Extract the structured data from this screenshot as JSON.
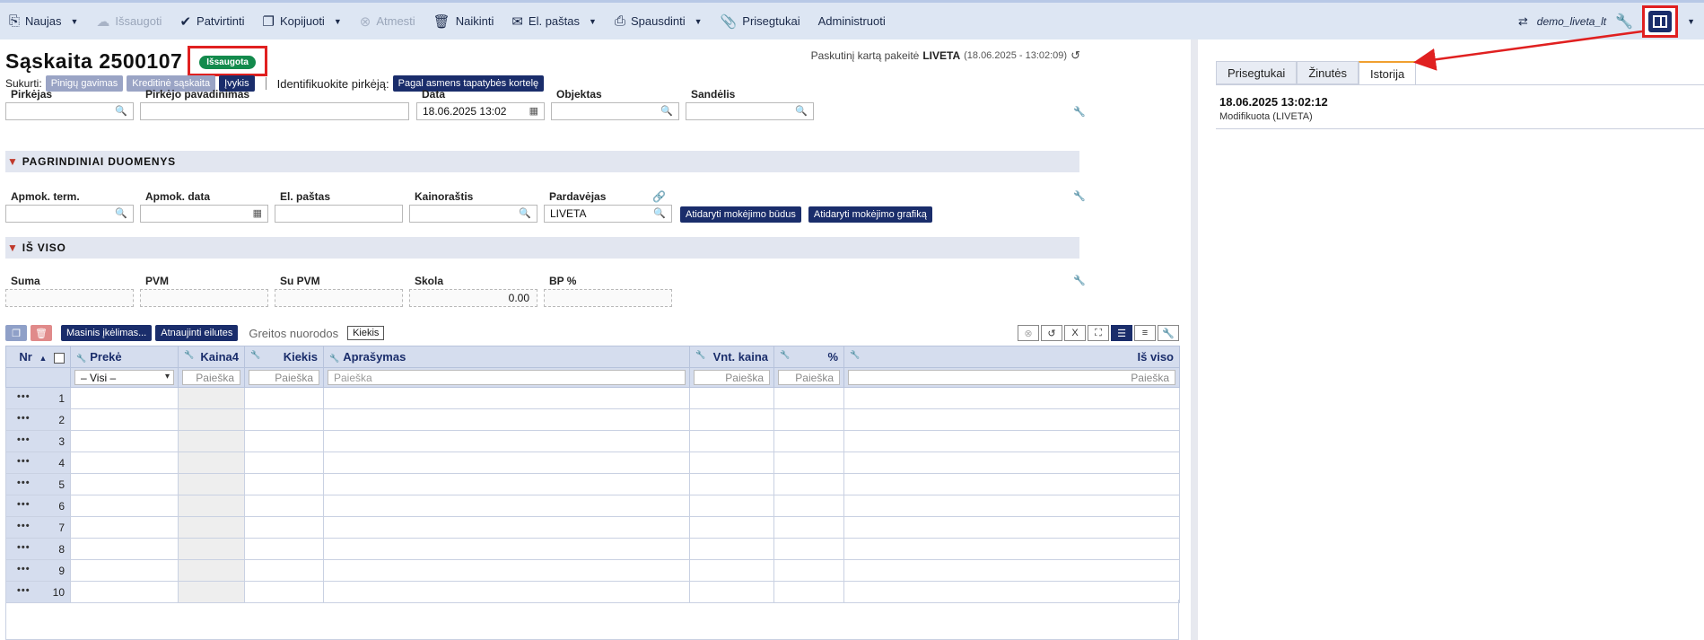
{
  "toolbar": {
    "new": "Naujas",
    "save": "Išsaugoti",
    "confirm": "Patvirtinti",
    "copy": "Kopijuoti",
    "cancel": "Atmesti",
    "delete": "Naikinti",
    "email": "El. paštas",
    "print": "Spausdinti",
    "attachments": "Prisegtukai",
    "administrate": "Administruoti",
    "user": "demo_liveta_lt"
  },
  "header": {
    "title": "Sąskaita 2500107",
    "status": "Išsaugota",
    "last_modified_label": "Paskutinį kartą pakeitė",
    "last_modified_user": "LIVETA",
    "last_modified_time": "(18.06.2025 - 13:02:09)"
  },
  "create": {
    "label": "Sukurti:",
    "payment_request": "Pinigų gavimas",
    "credit_invoice": "Kreditinė sąskaita",
    "event": "Įvykis",
    "identify_label": "Identifikuokite pirkėją:",
    "identify_button": "Pagal asmens tapatybės kortelę"
  },
  "fields": {
    "buyer": {
      "label": "Pirkėjas",
      "value": ""
    },
    "buyer_name": {
      "label": "Pirkėjo pavadinimas",
      "value": ""
    },
    "date": {
      "label": "Data",
      "value": "18.06.2025 13:02"
    },
    "object": {
      "label": "Objektas",
      "value": ""
    },
    "warehouse": {
      "label": "Sandėlis",
      "value": ""
    }
  },
  "section_main": {
    "title": "PAGRINDINIAI DUOMENYS",
    "payment_term": {
      "label": "Apmok. term.",
      "value": ""
    },
    "payment_date": {
      "label": "Apmok. data",
      "value": ""
    },
    "email": {
      "label": "El. paštas",
      "value": ""
    },
    "pricelist": {
      "label": "Kainoraštis",
      "value": ""
    },
    "seller": {
      "label": "Pardavėjas",
      "value": "LIVETA"
    },
    "open_payment_methods": "Atidaryti mokėjimo būdus",
    "open_payment_schedule": "Atidaryti mokėjimo grafiką"
  },
  "section_totals": {
    "title": "IŠ VISO",
    "sum": {
      "label": "Suma",
      "value": ""
    },
    "vat": {
      "label": "PVM",
      "value": ""
    },
    "with_vat": {
      "label": "Su PVM",
      "value": ""
    },
    "debt": {
      "label": "Skola",
      "value": "0.00"
    },
    "bp": {
      "label": "BP %",
      "value": ""
    }
  },
  "grid_toolbar": {
    "mass_upload": "Masinis įkėlimas...",
    "update_rows": "Atnaujinti eilutes",
    "quick_links": "Greitos nuorodos",
    "quantity": "Kiekis"
  },
  "grid": {
    "columns": [
      "Nr",
      "Prekė",
      "Kaina4",
      "Kiekis",
      "Aprašymas",
      "Vnt. kaina",
      "%",
      "Iš viso"
    ],
    "filter_all": "– Visi –",
    "filter_search": "Paieška",
    "rows": [
      "1",
      "2",
      "3",
      "4",
      "5",
      "6",
      "7",
      "8",
      "9",
      "10"
    ]
  },
  "side_panel": {
    "tabs": [
      "Prisegtukai",
      "Žinutės",
      "Istorija"
    ],
    "active_tab": "Istorija",
    "history": [
      {
        "date": "18.06.2025 13:02:12",
        "desc": "Modifikuota (LIVETA)"
      }
    ]
  },
  "colors": {
    "accent_navy": "#1a2d6b",
    "status_green": "#138a4c",
    "highlight_red": "#e02020",
    "tab_active_orange": "#f0a030"
  }
}
